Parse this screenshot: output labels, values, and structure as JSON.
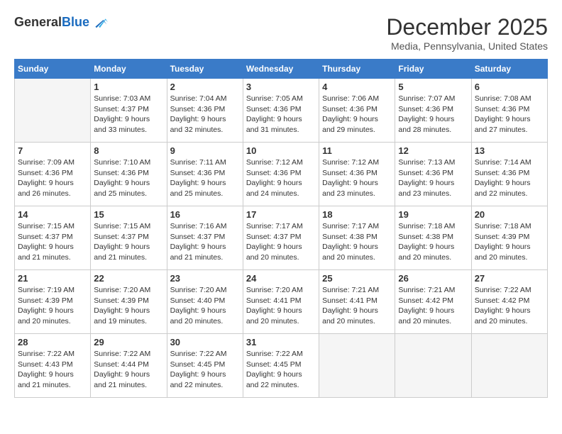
{
  "logo": {
    "general": "General",
    "blue": "Blue"
  },
  "header": {
    "month": "December 2025",
    "location": "Media, Pennsylvania, United States"
  },
  "days_of_week": [
    "Sunday",
    "Monday",
    "Tuesday",
    "Wednesday",
    "Thursday",
    "Friday",
    "Saturday"
  ],
  "weeks": [
    [
      {
        "day": "",
        "empty": true
      },
      {
        "day": "1",
        "sunrise": "7:03 AM",
        "sunset": "4:37 PM",
        "daylight": "9 hours and 33 minutes."
      },
      {
        "day": "2",
        "sunrise": "7:04 AM",
        "sunset": "4:36 PM",
        "daylight": "9 hours and 32 minutes."
      },
      {
        "day": "3",
        "sunrise": "7:05 AM",
        "sunset": "4:36 PM",
        "daylight": "9 hours and 31 minutes."
      },
      {
        "day": "4",
        "sunrise": "7:06 AM",
        "sunset": "4:36 PM",
        "daylight": "9 hours and 29 minutes."
      },
      {
        "day": "5",
        "sunrise": "7:07 AM",
        "sunset": "4:36 PM",
        "daylight": "9 hours and 28 minutes."
      },
      {
        "day": "6",
        "sunrise": "7:08 AM",
        "sunset": "4:36 PM",
        "daylight": "9 hours and 27 minutes."
      }
    ],
    [
      {
        "day": "7",
        "sunrise": "7:09 AM",
        "sunset": "4:36 PM",
        "daylight": "9 hours and 26 minutes."
      },
      {
        "day": "8",
        "sunrise": "7:10 AM",
        "sunset": "4:36 PM",
        "daylight": "9 hours and 25 minutes."
      },
      {
        "day": "9",
        "sunrise": "7:11 AM",
        "sunset": "4:36 PM",
        "daylight": "9 hours and 25 minutes."
      },
      {
        "day": "10",
        "sunrise": "7:12 AM",
        "sunset": "4:36 PM",
        "daylight": "9 hours and 24 minutes."
      },
      {
        "day": "11",
        "sunrise": "7:12 AM",
        "sunset": "4:36 PM",
        "daylight": "9 hours and 23 minutes."
      },
      {
        "day": "12",
        "sunrise": "7:13 AM",
        "sunset": "4:36 PM",
        "daylight": "9 hours and 23 minutes."
      },
      {
        "day": "13",
        "sunrise": "7:14 AM",
        "sunset": "4:36 PM",
        "daylight": "9 hours and 22 minutes."
      }
    ],
    [
      {
        "day": "14",
        "sunrise": "7:15 AM",
        "sunset": "4:37 PM",
        "daylight": "9 hours and 21 minutes."
      },
      {
        "day": "15",
        "sunrise": "7:15 AM",
        "sunset": "4:37 PM",
        "daylight": "9 hours and 21 minutes."
      },
      {
        "day": "16",
        "sunrise": "7:16 AM",
        "sunset": "4:37 PM",
        "daylight": "9 hours and 21 minutes."
      },
      {
        "day": "17",
        "sunrise": "7:17 AM",
        "sunset": "4:37 PM",
        "daylight": "9 hours and 20 minutes."
      },
      {
        "day": "18",
        "sunrise": "7:17 AM",
        "sunset": "4:38 PM",
        "daylight": "9 hours and 20 minutes."
      },
      {
        "day": "19",
        "sunrise": "7:18 AM",
        "sunset": "4:38 PM",
        "daylight": "9 hours and 20 minutes."
      },
      {
        "day": "20",
        "sunrise": "7:18 AM",
        "sunset": "4:39 PM",
        "daylight": "9 hours and 20 minutes."
      }
    ],
    [
      {
        "day": "21",
        "sunrise": "7:19 AM",
        "sunset": "4:39 PM",
        "daylight": "9 hours and 20 minutes."
      },
      {
        "day": "22",
        "sunrise": "7:20 AM",
        "sunset": "4:39 PM",
        "daylight": "9 hours and 19 minutes."
      },
      {
        "day": "23",
        "sunrise": "7:20 AM",
        "sunset": "4:40 PM",
        "daylight": "9 hours and 20 minutes."
      },
      {
        "day": "24",
        "sunrise": "7:20 AM",
        "sunset": "4:41 PM",
        "daylight": "9 hours and 20 minutes."
      },
      {
        "day": "25",
        "sunrise": "7:21 AM",
        "sunset": "4:41 PM",
        "daylight": "9 hours and 20 minutes."
      },
      {
        "day": "26",
        "sunrise": "7:21 AM",
        "sunset": "4:42 PM",
        "daylight": "9 hours and 20 minutes."
      },
      {
        "day": "27",
        "sunrise": "7:22 AM",
        "sunset": "4:42 PM",
        "daylight": "9 hours and 20 minutes."
      }
    ],
    [
      {
        "day": "28",
        "sunrise": "7:22 AM",
        "sunset": "4:43 PM",
        "daylight": "9 hours and 21 minutes."
      },
      {
        "day": "29",
        "sunrise": "7:22 AM",
        "sunset": "4:44 PM",
        "daylight": "9 hours and 21 minutes."
      },
      {
        "day": "30",
        "sunrise": "7:22 AM",
        "sunset": "4:45 PM",
        "daylight": "9 hours and 22 minutes."
      },
      {
        "day": "31",
        "sunrise": "7:22 AM",
        "sunset": "4:45 PM",
        "daylight": "9 hours and 22 minutes."
      },
      {
        "day": "",
        "empty": true
      },
      {
        "day": "",
        "empty": true
      },
      {
        "day": "",
        "empty": true
      }
    ]
  ],
  "labels": {
    "sunrise": "Sunrise:",
    "sunset": "Sunset:",
    "daylight": "Daylight:"
  }
}
